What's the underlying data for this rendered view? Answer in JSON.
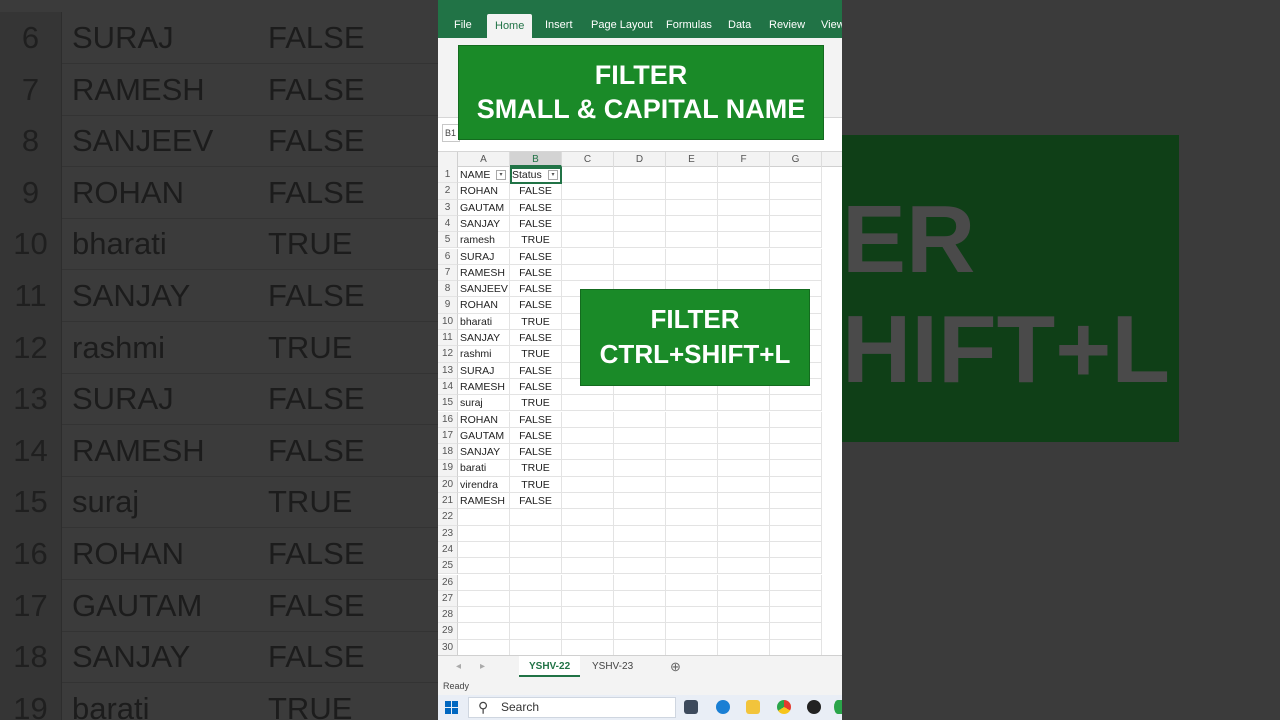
{
  "background": {
    "rows": [
      {
        "n": "6",
        "name": "SURAJ",
        "status": "FALSE"
      },
      {
        "n": "7",
        "name": "RAMESH",
        "status": "FALSE"
      },
      {
        "n": "8",
        "name": "SANJEEV",
        "status": "FALSE"
      },
      {
        "n": "9",
        "name": "ROHAN",
        "status": "FALSE"
      },
      {
        "n": "10",
        "name": "bharati",
        "status": "TRUE"
      },
      {
        "n": "11",
        "name": "SANJAY",
        "status": "FALSE"
      },
      {
        "n": "12",
        "name": "rashmi",
        "status": "TRUE"
      },
      {
        "n": "13",
        "name": "SURAJ",
        "status": "FALSE"
      },
      {
        "n": "14",
        "name": "RAMESH",
        "status": "FALSE"
      },
      {
        "n": "15",
        "name": "suraj",
        "status": "TRUE"
      },
      {
        "n": "16",
        "name": "ROHAN",
        "status": "FALSE"
      },
      {
        "n": "17",
        "name": "GAUTAM",
        "status": "FALSE"
      },
      {
        "n": "18",
        "name": "SANJAY",
        "status": "FALSE"
      },
      {
        "n": "19",
        "name": "barati",
        "status": "TRUE"
      }
    ],
    "big_text_1": "ER",
    "big_text_2": "HIFT+L"
  },
  "ribbon": {
    "tabs": [
      "File",
      "Home",
      "Insert",
      "Page Layout",
      "Formulas",
      "Data",
      "Review",
      "View"
    ],
    "active_tab": "Home"
  },
  "name_box": "B1",
  "banner_top": {
    "line1": "FILTER",
    "line2": "SMALL & CAPITAL NAME"
  },
  "banner_mid": {
    "line1": "FILTER",
    "line2": "CTRL+SHIFT+L"
  },
  "columns": [
    "A",
    "B",
    "C",
    "D",
    "E",
    "F",
    "G"
  ],
  "header_row": {
    "name": "NAME",
    "status": "Status"
  },
  "rows": [
    {
      "name": "ROHAN",
      "status": "FALSE"
    },
    {
      "name": "GAUTAM",
      "status": "FALSE"
    },
    {
      "name": "SANJAY",
      "status": "FALSE"
    },
    {
      "name": "ramesh",
      "status": "TRUE"
    },
    {
      "name": "SURAJ",
      "status": "FALSE"
    },
    {
      "name": "RAMESH",
      "status": "FALSE"
    },
    {
      "name": "SANJEEV",
      "status": "FALSE"
    },
    {
      "name": "ROHAN",
      "status": "FALSE"
    },
    {
      "name": "bharati",
      "status": "TRUE"
    },
    {
      "name": "SANJAY",
      "status": "FALSE"
    },
    {
      "name": "rashmi",
      "status": "TRUE"
    },
    {
      "name": "SURAJ",
      "status": "FALSE"
    },
    {
      "name": "RAMESH",
      "status": "FALSE"
    },
    {
      "name": "suraj",
      "status": "TRUE"
    },
    {
      "name": "ROHAN",
      "status": "FALSE"
    },
    {
      "name": "GAUTAM",
      "status": "FALSE"
    },
    {
      "name": "SANJAY",
      "status": "FALSE"
    },
    {
      "name": "barati",
      "status": "TRUE"
    },
    {
      "name": "virendra",
      "status": "TRUE"
    },
    {
      "name": "RAMESH",
      "status": "FALSE"
    }
  ],
  "total_rows": 30,
  "sheet_tabs": [
    "YSHV-22",
    "YSHV-23"
  ],
  "active_sheet": "YSHV-22",
  "status_text": "Ready",
  "taskbar": {
    "search_label": "Search"
  },
  "colors": {
    "excel_green": "#217346",
    "banner_green": "#1a8a28"
  }
}
